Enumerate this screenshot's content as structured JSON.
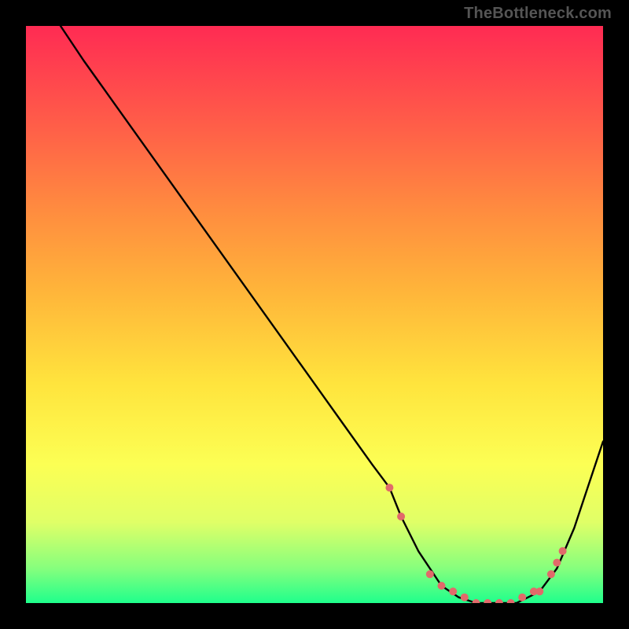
{
  "attribution": "TheBottleneck.com",
  "chart_data": {
    "type": "line",
    "title": "",
    "xlabel": "",
    "ylabel": "",
    "xlim": [
      0,
      100
    ],
    "ylim": [
      0,
      100
    ],
    "grid": false,
    "legend": false,
    "background_gradient": {
      "top": "#ff2b53",
      "bottom": "#1fff8c",
      "meaning": "red=high bottleneck, green=low bottleneck"
    },
    "series": [
      {
        "name": "bottleneck-curve",
        "color": "#000000",
        "x": [
          6,
          10,
          15,
          20,
          25,
          30,
          35,
          40,
          45,
          50,
          55,
          60,
          63,
          65,
          68,
          72,
          75,
          78,
          80,
          83,
          85,
          87,
          89,
          92,
          95,
          98,
          100
        ],
        "y": [
          100,
          94,
          87,
          80,
          73,
          66,
          59,
          52,
          45,
          38,
          31,
          24,
          20,
          15,
          9,
          3,
          1,
          0,
          0,
          0,
          0,
          1,
          2,
          6,
          13,
          22,
          28
        ]
      },
      {
        "name": "highlight-dots",
        "type": "scatter",
        "color": "#e16a6a",
        "x": [
          63,
          65,
          70,
          72,
          74,
          76,
          78,
          80,
          82,
          84,
          86,
          88,
          89,
          91,
          92,
          93
        ],
        "y": [
          20,
          15,
          5,
          3,
          2,
          1,
          0,
          0,
          0,
          0,
          1,
          2,
          2,
          5,
          7,
          9
        ]
      }
    ]
  }
}
